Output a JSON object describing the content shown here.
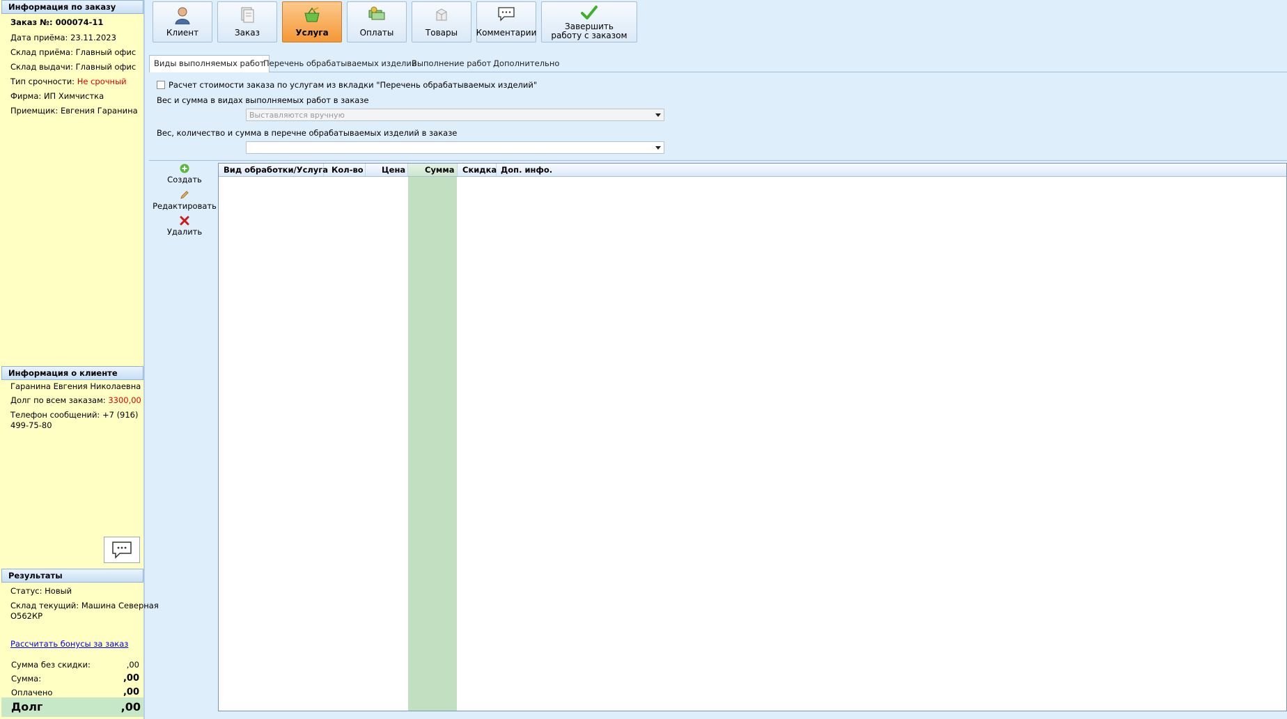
{
  "order_info": {
    "header": "Информация по заказу",
    "order_number": "Заказ №: 000074-11",
    "date_label": "Дата приёма:",
    "date_value": "23.11.2023",
    "warehouse_in_label": "Склад приёма:",
    "warehouse_in_value": "Главный офис",
    "warehouse_out_label": "Склад выдачи:",
    "warehouse_out_value": "Главный офис",
    "urgency_label": "Тип срочности:",
    "urgency_value": "Не срочный",
    "firm_label": "Фирма:",
    "firm_value": "ИП Химчистка",
    "receiver_label": "Приемщик:",
    "receiver_value": "Евгения Гаранина"
  },
  "client_info": {
    "header": "Информация о клиенте",
    "name": "Гаранина Евгения Николаевна",
    "debt_label": "Долг по всем заказам:",
    "debt_value": "3300,00",
    "phone_line1": "Телефон сообщений: +7 (916)",
    "phone_line2": "499-75-80"
  },
  "results": {
    "header": "Результаты",
    "status": "Статус: Новый",
    "warehouse_line1": "Склад текущий: Машина Северная",
    "warehouse_line2": "О562КР",
    "bonus_link": "Рассчитать бонусы за заказ",
    "sum_no_discount_label": "Сумма без скидки:",
    "sum_no_discount_value": ",00",
    "sum_label": "Сумма:",
    "sum_value": ",00",
    "paid_label": "Оплачено",
    "paid_value": ",00",
    "debt_label": "Долг",
    "debt_value": ",00"
  },
  "toolbar": {
    "client": "Клиент",
    "order": "Заказ",
    "service": "Услуга",
    "payments": "Оплаты",
    "goods": "Товары",
    "comments": "Комментарии",
    "finish_line1": "Завершить",
    "finish_line2": "работу с заказом",
    "active": "service"
  },
  "tabs": [
    {
      "label": "Виды выполняемых работ",
      "active": true
    },
    {
      "label": "Перечень обрабатываемых изделий",
      "active": false
    },
    {
      "label": "Выполнение работ",
      "active": false
    },
    {
      "label": "Дополнительно",
      "active": false
    }
  ],
  "options": {
    "calc_checkbox_label": "Расчет стоимости заказа по услугам из вкладки \"Перечень обрабатываемых изделий\"",
    "calc_checked": false,
    "weight_sum_label": "Вес и сумма в видах выполняемых работ в заказе",
    "weight_sum_value": "Выставляются вручную",
    "weight_qty_label": "Вес, количество и сумма в перечне обрабатываемых изделий в заказе",
    "weight_qty_value": ""
  },
  "actions": {
    "create": "Создать",
    "edit": "Редактировать",
    "delete": "Удалить"
  },
  "grid": {
    "columns": [
      "Вид обработки/Услуга",
      "Кол-во",
      "Цена",
      "Сумма",
      "Скидка",
      "Доп. инфо."
    ],
    "rows": []
  },
  "colors": {
    "active_tab_button": "#f49836",
    "left_panel": "#ffffc4",
    "sum_column": "#c2dfc2",
    "debt_row": "#c7e8c7",
    "urgency_text": "#e00000"
  },
  "icons": {
    "client": "person-icon",
    "order": "document-icon",
    "service": "basket-icon",
    "payments": "money-icon",
    "goods": "box-icon",
    "comments": "speech-bubble-icon",
    "finish": "checkmark-icon",
    "create": "plus-icon",
    "edit": "pencil-icon",
    "delete": "cross-icon"
  }
}
